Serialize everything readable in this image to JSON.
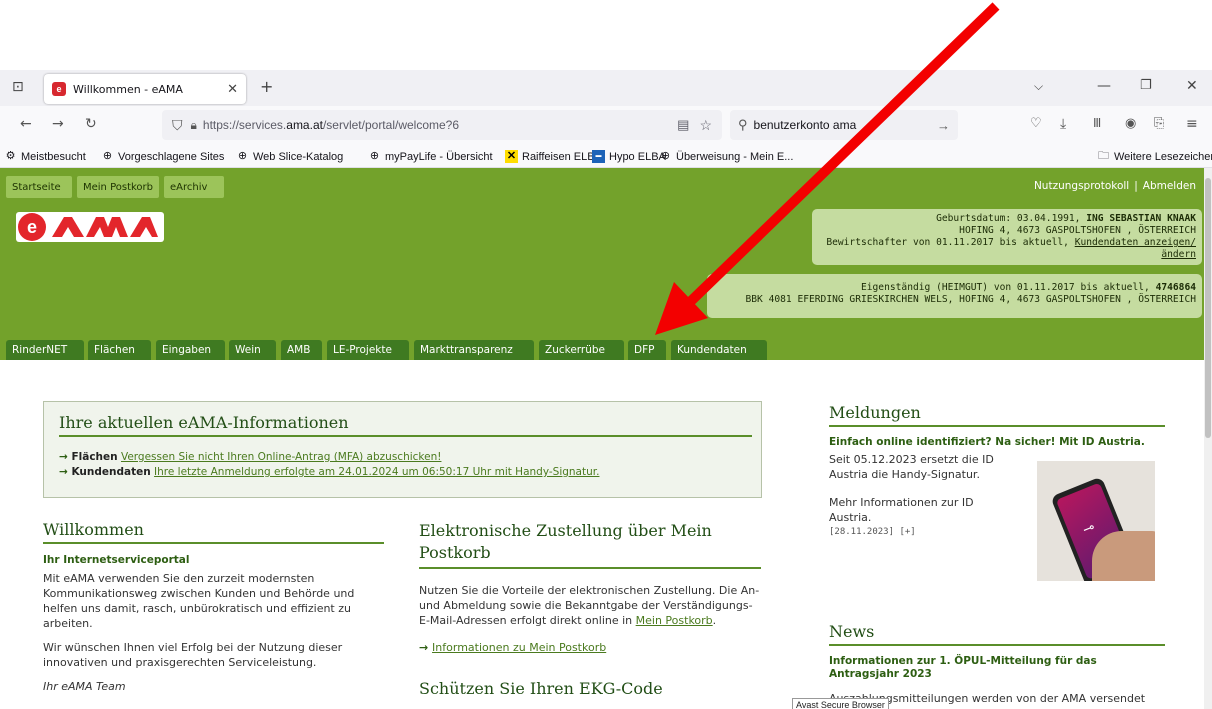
{
  "browser": {
    "tab_title": "Willkommen - eAMA",
    "favicon_letter": "e",
    "new_tab": "+",
    "url_prefix": "https://services.",
    "url_domain": "ama.at",
    "url_suffix": "/servlet/portal/welcome?6",
    "search_value": "benutzerkonto ama",
    "bookmarks": [
      "Meistbesucht",
      "Vorgeschlagene Sites",
      "Web Slice-Katalog",
      "myPayLife - Übersicht",
      "Raiffeisen ELBA",
      "Hypo ELBA",
      "Überweisung - Mein E...",
      "Weitere Lesezeichen"
    ],
    "status_tooltip": "Avast Secure Browser"
  },
  "header": {
    "top_links": [
      "Startseite",
      "Mein Postkorb",
      "eArchiv"
    ],
    "right_links": [
      "Nutzungsprotokoll",
      "|",
      "Abmelden"
    ],
    "logo": "eAMA",
    "user": {
      "line1_prefix": "Geburtsdatum: 03.04.1991, ",
      "name": "ING SEBASTIAN KNAAK",
      "line2": "HOFING 4, 4673 GASPOLTSHOFEN , ÖSTERREICH",
      "line3_prefix": "Bewirtschafter von 01.11.2017 bis aktuell, ",
      "line3_link": "Kundendaten anzeigen/ändern"
    },
    "farm": {
      "line1_prefix": "Eigenständig (HEIMGUT) von 01.11.2017 bis aktuell, ",
      "number": "4746864",
      "line2": "BBK 4081 EFERDING GRIESKIRCHEN WELS, HOFING 4, 4673 GASPOLTSHOFEN , ÖSTERREICH"
    },
    "tabs": [
      "RinderNET",
      "Flächen",
      "Eingaben",
      "Wein",
      "AMB",
      "LE-Projekte",
      "Markttransparenz",
      "Zuckerrübe",
      "DFP",
      "Kundendaten"
    ]
  },
  "info": {
    "title": "Ihre aktuellen eAMA-Informationen",
    "items": [
      {
        "label": "Flächen",
        "text": "Vergessen Sie nicht Ihren Online-Antrag (MFA) abzuschicken!"
      },
      {
        "label": "Kundendaten",
        "text": "Ihre letzte Anmeldung erfolgte am 24.01.2024 um 06:50:17 Uhr mit Handy-Signatur."
      }
    ]
  },
  "welcome": {
    "title": "Willkommen",
    "subtitle": "Ihr Internetserviceportal",
    "p1": "Mit eAMA verwenden Sie den zurzeit modernsten Kommunikationsweg zwischen Kunden und Behörde und helfen uns damit, rasch, unbürokratisch und effizient zu arbeiten.",
    "p2": "Wir wünschen Ihnen viel Erfolg bei der Nutzung dieser innovativen und praxisgerechten Serviceleistung.",
    "sign": "Ihr eAMA Team"
  },
  "zustellung": {
    "title": "Elektronische Zustellung über Mein Postkorb",
    "p1": "Nutzen Sie die Vorteile der elektronischen Zustellung. Die An- und Abmeldung sowie die Bekanntgabe der Verständigungs-E-Mail-Adressen erfolgt direkt online in ",
    "p1_link": "Mein Postkorb",
    "p1_end": ".",
    "link": "Informationen zu Mein Postkorb",
    "next_title": "Schützen Sie Ihren EKG-Code"
  },
  "meldungen": {
    "title": "Meldungen",
    "headline": "Einfach online identifiziert? Na sicher! Mit ID Austria.",
    "text": "Seit 05.12.2023 ersetzt die ID Austria die Handy-Signatur.",
    "text2": "Mehr Informationen zur ID Austria.",
    "date": "[28.11.2023] [+]"
  },
  "news": {
    "title": "News",
    "headline": "Informationen zur 1. ÖPUL-Mitteilung für das Antragsjahr 2023",
    "text": "Auszahlungsmitteilungen werden von der AMA versendet"
  }
}
